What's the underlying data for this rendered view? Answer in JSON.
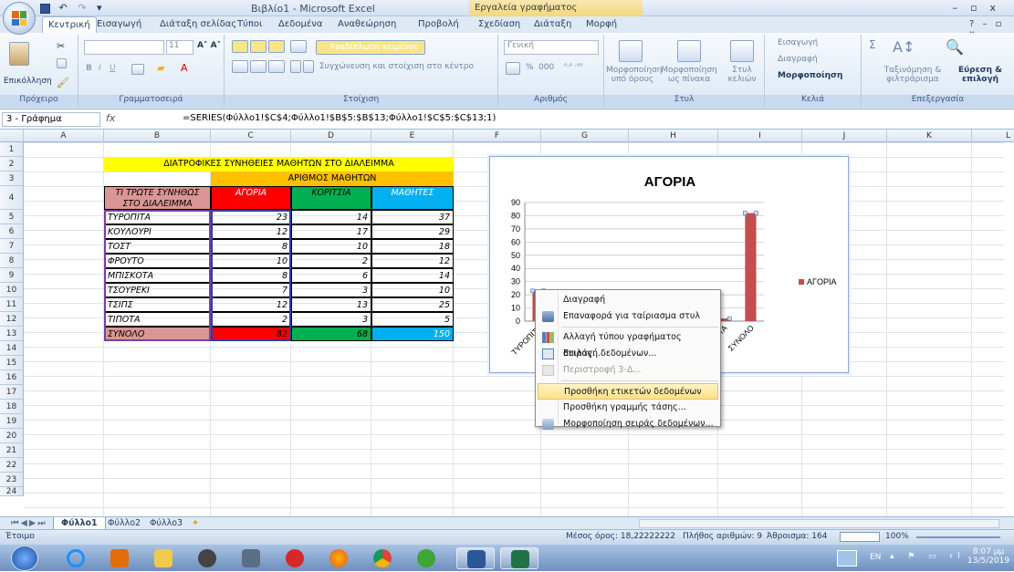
{
  "window": {
    "title": "Βιβλίο1 - Microsoft Excel",
    "context_tools": "Εργαλεία γραφήματος",
    "controls": [
      "–",
      "▫",
      "x"
    ]
  },
  "tabs": [
    "Κεντρική",
    "Εισαγωγή",
    "Διάταξη σελίδας",
    "Τύποι",
    "Δεδομένα",
    "Αναθεώρηση",
    "Προβολή",
    "Σχεδίαση",
    "Διάταξη",
    "Μορφή"
  ],
  "active_tab": "Κεντρική",
  "ribbon": {
    "paste_label": "Επικόλληση",
    "clipboard_group": "Πρόχειρο",
    "font_group": "Γραμματοσειρά",
    "font_size": "11",
    "alignment_group": "Στοίχιση",
    "wrap_text": "Αναδίπλωση κειμένου",
    "merge_center": "Συγχώνευση και στοίχιση στο κέντρο",
    "number_group": "Αριθμός",
    "number_format": "Γενική",
    "percent_label": "%",
    "thousands_label": "000",
    "cond_format": "Μορφοποίηση υπό όρους",
    "format_table": "Μορφοποίηση ως πίνακα",
    "cell_styles": "Στυλ κελιών",
    "styles_group": "Στυλ",
    "insert_label": "Εισαγωγή",
    "delete_label": "Διαγραφή",
    "format_label": "Μορφοποίηση",
    "cells_group": "Κελιά",
    "sum_label": "Σ",
    "sort_filter": "Ταξινόμηση & φιλτράρισμα",
    "find_select": "Εύρεση & επιλογή",
    "editing_group": "Επεξεργασία"
  },
  "formula_bar": {
    "name_box": "3 - Γράφημα",
    "fx": "fx",
    "formula": "=SERIES(Φύλλο1!$C$4;Φύλλο1!$B$5:$B$13;Φύλλο1!$C$5:$C$13;1)"
  },
  "columns": [
    "A",
    "B",
    "C",
    "D",
    "E",
    "F",
    "G",
    "H",
    "I",
    "J",
    "K",
    "L"
  ],
  "rows": [
    "1",
    "2",
    "3",
    "4",
    "5",
    "6",
    "7",
    "8",
    "9",
    "10",
    "11",
    "12",
    "13",
    "14",
    "15",
    "16",
    "17",
    "18",
    "19",
    "20",
    "21",
    "22",
    "23",
    "24"
  ],
  "table": {
    "title": "ΔΙΑΤΡΟΦΙΚΕΣ ΣΥΝΗΘΕΙΕΣ ΜΑΘΗΤΩΝ ΣΤΟ ΔΙΑΛΕΙΜΜΑ",
    "subtitle": "ΑΡΙΘΜΟΣ ΜΑΘΗΤΩΝ",
    "header_q_line1": "ΤΙ ΤΡΩΤΕ ΣΥΝΗΘΩΣ",
    "header_q_line2": "ΣΤΟ ΔΙΑΛΕΙΜΜΑ",
    "header_boys": "ΑΓΟΡΙΑ",
    "header_girls": "ΚΟΡΙΤΣΙΑ",
    "header_students": "ΜΑΘΗΤΕΣ",
    "rows": [
      {
        "item": "ΤΥΡΟΠΙΤΑ",
        "boys": "23",
        "girls": "14",
        "total": "37"
      },
      {
        "item": "ΚΟΥΛΟΥΡΙ",
        "boys": "12",
        "girls": "17",
        "total": "29"
      },
      {
        "item": "ΤΟΣΤ",
        "boys": "8",
        "girls": "10",
        "total": "18"
      },
      {
        "item": "ΦΡΟΥΤΟ",
        "boys": "10",
        "girls": "2",
        "total": "12"
      },
      {
        "item": "ΜΠΙΣΚΟΤΑ",
        "boys": "8",
        "girls": "6",
        "total": "14"
      },
      {
        "item": "ΤΣΟΥΡΕΚΙ",
        "boys": "7",
        "girls": "3",
        "total": "10"
      },
      {
        "item": "ΤΣΙΠΣ",
        "boys": "12",
        "girls": "13",
        "total": "25"
      },
      {
        "item": "ΤΙΠΟΤΑ",
        "boys": "2",
        "girls": "3",
        "total": "5"
      },
      {
        "item": "ΣΥΝΟΛΟ",
        "boys": "82",
        "girls": "68",
        "total": "150"
      }
    ]
  },
  "colors": {
    "title_yellow": "#ffff00",
    "subtitle_orange": "#ffc000",
    "header_rose": "#da9694",
    "boys_red": "#ff0000",
    "girls_green": "#00b050",
    "students_blue": "#00b0f0",
    "series_bar": "#c0504d"
  },
  "chart_data": {
    "type": "bar",
    "title": "ΑΓΟΡΙΑ",
    "categories": [
      "ΤΥΡΟΠΙΤΑ",
      "ΚΟΥΛΟΥΡΙ",
      "ΤΟΣΤ",
      "ΦΡΟΥΤΟ",
      "ΜΠΙΣΚΟΤΑ",
      "ΤΣΟΥΡΕΚΙ",
      "ΤΣΙΠΣ",
      "ΤΙΠΟΤΑ",
      "ΣΥΝΟΛΟ"
    ],
    "visible_category_labels": [
      "ΤΥΡΟΠΙΤΑ",
      "ΚΟ",
      "ΙΠΟΤΑ",
      "ΣΥΝΟΛΟ"
    ],
    "series": [
      {
        "name": "ΑΓΟΡΙΑ",
        "values": [
          23,
          12,
          8,
          10,
          8,
          7,
          12,
          2,
          82
        ]
      }
    ],
    "ylim": [
      0,
      90
    ],
    "yticks": [
      "0",
      "10",
      "20",
      "30",
      "40",
      "50",
      "60",
      "70",
      "80",
      "90"
    ],
    "legend_position": "right",
    "grid": true,
    "selected_series": true
  },
  "context_menu": {
    "items": [
      {
        "label": "Διαγραφή",
        "icon": "none",
        "disabled": false
      },
      {
        "label": "Επαναφορά για ταίριασμα στυλ",
        "icon": "reset-style-icon",
        "disabled": false
      },
      {
        "label": "Αλλαγή τύπου γραφήματος σειράς...",
        "icon": "chart-type-icon",
        "disabled": false
      },
      {
        "label": "Επιλογή δεδομένων...",
        "icon": "select-data-icon",
        "disabled": false
      },
      {
        "label": "Περιστροφή 3-Δ...",
        "icon": "rotate-3d-icon",
        "disabled": true
      },
      {
        "label": "Προσθήκη ετικετών δεδομένων",
        "icon": "none",
        "disabled": false,
        "highlighted": true
      },
      {
        "label": "Προσθήκη γραμμής τάσης...",
        "icon": "none",
        "disabled": false
      },
      {
        "label": "Μορφοποίηση σειράς δεδομένων...",
        "icon": "format-series-icon",
        "disabled": false
      }
    ]
  },
  "sheets": [
    "Φύλλο1",
    "Φύλλο2",
    "Φύλλο3"
  ],
  "active_sheet": "Φύλλο1",
  "status": {
    "mode": "Έτοιμο",
    "average": "Μέσος όρος: 18,22222222",
    "count": "Πλήθος αριθμών: 9",
    "sum": "Άθροισμα: 164",
    "zoom": "100%"
  },
  "taskbar": {
    "lang": "EN",
    "time": "8:07 μμ",
    "date": "13/5/2019"
  }
}
